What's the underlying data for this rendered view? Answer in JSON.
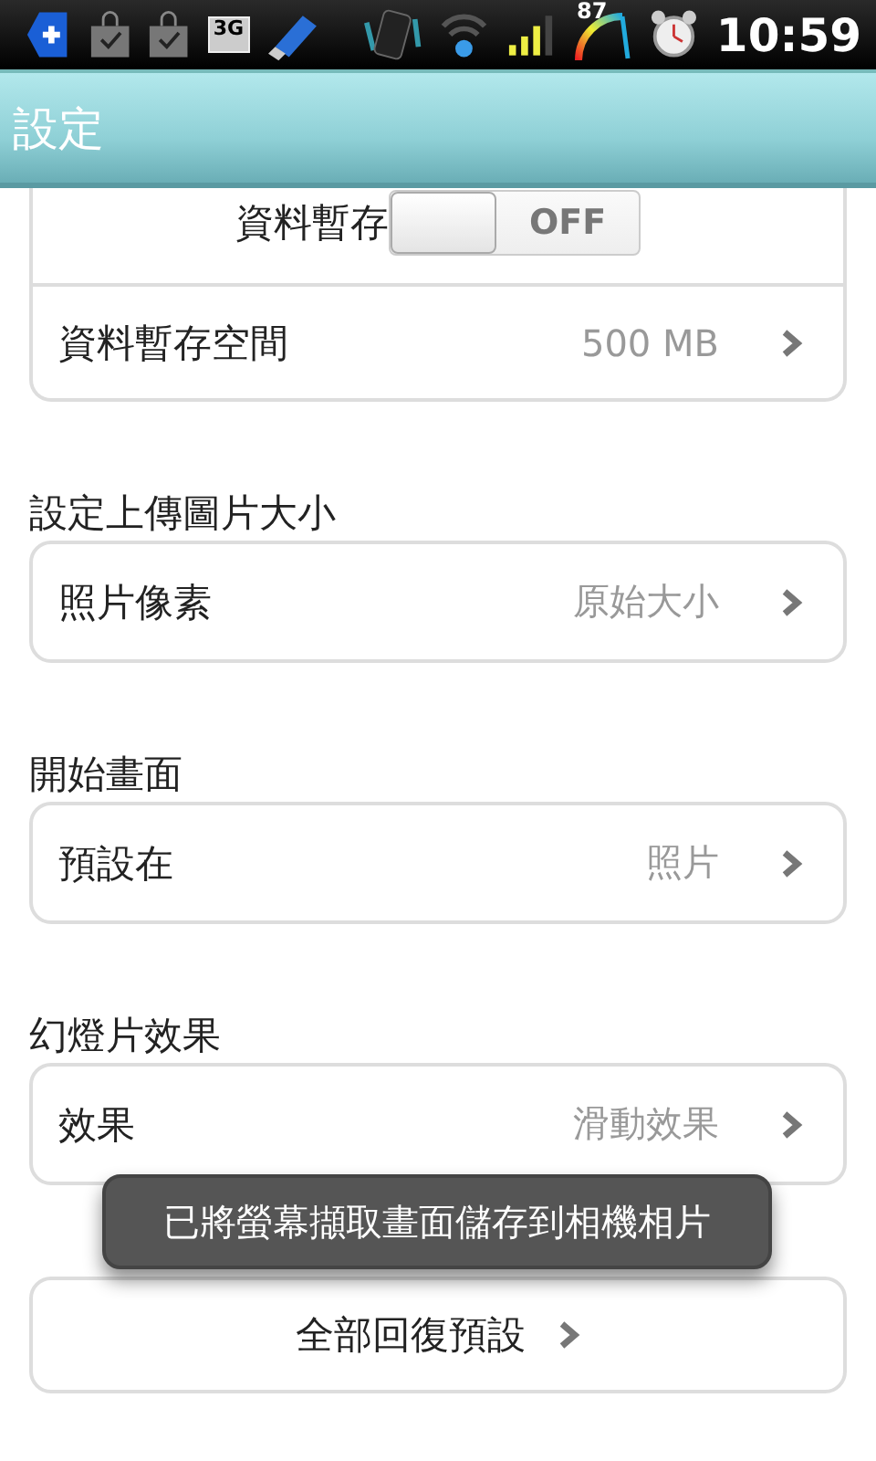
{
  "status_bar": {
    "network": "3G",
    "battery": "87",
    "time": "10:59"
  },
  "title": "設定",
  "top_group": {
    "toggle_row": {
      "label": "資料暫存",
      "toggle": {
        "label": "OFF",
        "on": false
      }
    },
    "rows": [
      {
        "label": "資料暫存空間",
        "value": "500 MB"
      }
    ]
  },
  "sections": [
    {
      "header": "設定上傳圖片大小",
      "rows": [
        {
          "label": "照片像素",
          "value": "原始大小"
        }
      ]
    },
    {
      "header": "開始畫面",
      "rows": [
        {
          "label": "預設在",
          "value": "照片"
        }
      ]
    },
    {
      "header": "幻燈片效果",
      "rows": [
        {
          "label": "效果",
          "value": "滑動效果"
        }
      ]
    }
  ],
  "reset_button": "全部回復預設",
  "toast": "已將螢幕擷取畫面儲存到相機相片"
}
